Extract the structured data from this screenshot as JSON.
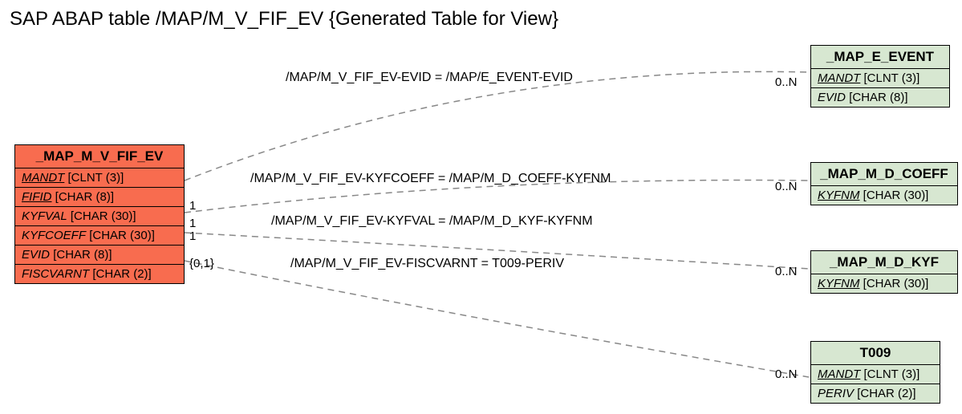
{
  "title": "SAP ABAP table /MAP/M_V_FIF_EV {Generated Table for View}",
  "main_entity": {
    "name": "_MAP_M_V_FIF_EV",
    "fields": [
      {
        "name": "MANDT",
        "type": "[CLNT (3)]",
        "underline": true
      },
      {
        "name": "FIFID",
        "type": "[CHAR (8)]",
        "underline": true
      },
      {
        "name": "KYFVAL",
        "type": "[CHAR (30)]",
        "underline": false
      },
      {
        "name": "KYFCOEFF",
        "type": "[CHAR (30)]",
        "underline": false
      },
      {
        "name": "EVID",
        "type": "[CHAR (8)]",
        "underline": false
      },
      {
        "name": "FISCVARNT",
        "type": "[CHAR (2)]",
        "underline": false
      }
    ]
  },
  "related": [
    {
      "name": "_MAP_E_EVENT",
      "fields": [
        {
          "name": "MANDT",
          "type": "[CLNT (3)]",
          "underline": true
        },
        {
          "name": "EVID",
          "type": "[CHAR (8)]",
          "underline": false
        }
      ]
    },
    {
      "name": "_MAP_M_D_COEFF",
      "fields": [
        {
          "name": "KYFNM",
          "type": "[CHAR (30)]",
          "underline": true
        }
      ]
    },
    {
      "name": "_MAP_M_D_KYF",
      "fields": [
        {
          "name": "KYFNM",
          "type": "[CHAR (30)]",
          "underline": true
        }
      ]
    },
    {
      "name": "T009",
      "fields": [
        {
          "name": "MANDT",
          "type": "[CLNT (3)]",
          "underline": true
        },
        {
          "name": "PERIV",
          "type": "[CHAR (2)]",
          "underline": false
        }
      ]
    }
  ],
  "relations": [
    {
      "label": "/MAP/M_V_FIF_EV-EVID = /MAP/E_EVENT-EVID",
      "left_card": "",
      "right_card": "0..N"
    },
    {
      "label": "/MAP/M_V_FIF_EV-KYFCOEFF = /MAP/M_D_COEFF-KYFNM",
      "left_card": "1",
      "right_card": "0..N"
    },
    {
      "label": "/MAP/M_V_FIF_EV-KYFVAL = /MAP/M_D_KYF-KYFNM",
      "left_card": "1",
      "right_card": "0..N"
    },
    {
      "label": "/MAP/M_V_FIF_EV-FISCVARNT = T009-PERIV",
      "left_card": "{0,1}",
      "right_card": "0..N"
    },
    {
      "label": "",
      "left_card": "1",
      "right_card": ""
    }
  ]
}
